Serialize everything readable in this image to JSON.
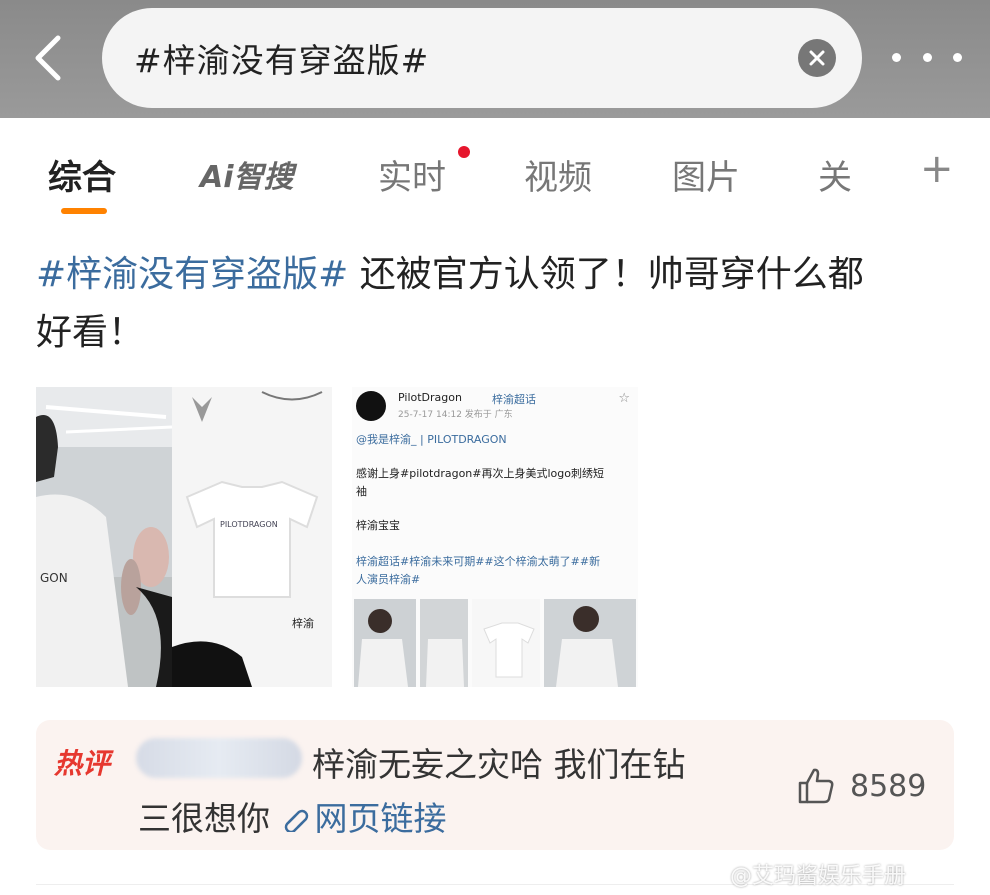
{
  "search": {
    "query": "#梓渝没有穿盗版#"
  },
  "tabs": [
    {
      "label": "综合"
    },
    {
      "label": "Ai智搜"
    },
    {
      "label": "实时"
    },
    {
      "label": "视频"
    },
    {
      "label": "图片"
    },
    {
      "label": "关"
    },
    {
      "label": "+"
    }
  ],
  "post": {
    "hashtag": "#梓渝没有穿盗版#",
    "text_line1": " 还被官方认领了！帅哥穿什么都",
    "text_line2": "好看！"
  },
  "embedded_post": {
    "account": "PilotDragon",
    "tag": "梓渝超话",
    "meta": "25-7-17 14:12 发布于 广东",
    "mention": "@我是梓渝_ | PILOTDRAGON",
    "body1": "感谢上身#pilotdragon#再次上身美式logo刺绣短",
    "body2": "袖",
    "body3": "梓渝宝宝",
    "tags1": "梓渝超话#梓渝未来可期##这个梓渝太萌了##新",
    "tags2": "人演员梓渝#",
    "shirt_label": "梓渝",
    "shirt_print": "PILOTDRAGON",
    "shirt_print_side": "GON"
  },
  "hot_comment": {
    "label": "热评",
    "line1": "梓渝无妄之灾哈 我们在钻",
    "line2": "三很想你 ",
    "link_text": "网页链接",
    "likes": "8589"
  },
  "watermark": "@艾玛酱娱乐手册",
  "colors": {
    "accent": "#ff8200",
    "link": "#3b6c9e",
    "hot": "#e6382f"
  }
}
